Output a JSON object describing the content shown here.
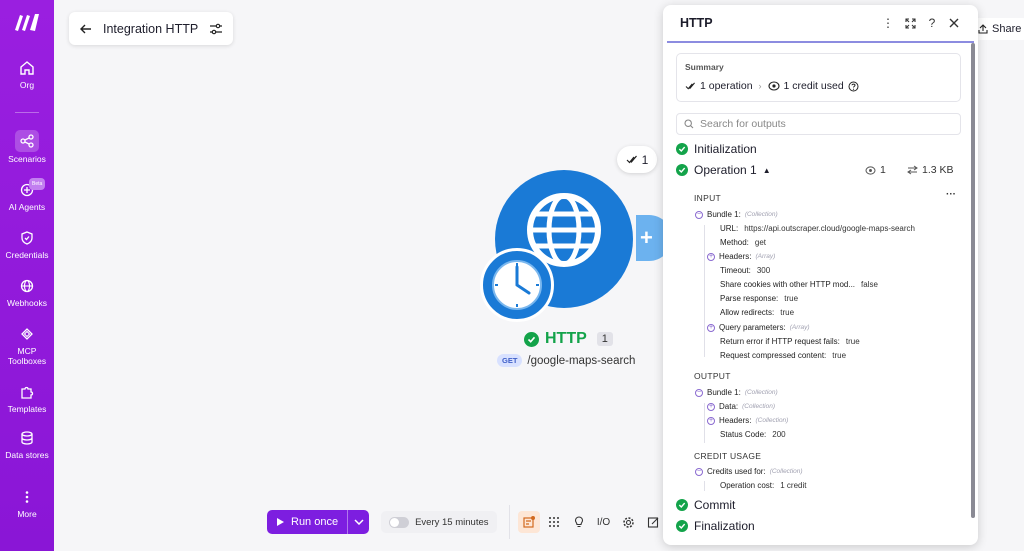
{
  "sidebar": {
    "items": [
      {
        "label": "Org",
        "icon": "home-icon"
      },
      {
        "label": "Scenarios",
        "icon": "share-nodes-icon",
        "active": true
      },
      {
        "label": "AI Agents",
        "icon": "ai-agent-icon",
        "badge": "Beta"
      },
      {
        "label": "Credentials",
        "icon": "shield-icon"
      },
      {
        "label": "Webhooks",
        "icon": "globe-icon"
      },
      {
        "label": "MCP Toolboxes",
        "icon": "mcp-icon"
      },
      {
        "label": "Templates",
        "icon": "puzzle-icon"
      },
      {
        "label": "Data stores",
        "icon": "database-icon"
      },
      {
        "label": "More",
        "icon": "more-vertical-icon"
      }
    ]
  },
  "header": {
    "scenario_title": "Integration HTTP",
    "share_label": "Share"
  },
  "canvas": {
    "node_name": "HTTP",
    "node_count": "1",
    "method": "GET",
    "path": "/google-maps-search",
    "ops_badge": "1"
  },
  "toolbar": {
    "run_label": "Run once",
    "schedule_label": "Every 15 minutes",
    "io_label": "I/O"
  },
  "panel": {
    "title": "HTTP",
    "summary_label": "Summary",
    "operations": "1 operation",
    "credits": "1 credit used",
    "search_placeholder": "Search for outputs",
    "steps": {
      "initialization": "Initialization",
      "operation": "Operation 1",
      "commit": "Commit",
      "finalization": "Finalization"
    },
    "op_ops": "1",
    "op_size": "1.3 KB",
    "input_title": "INPUT",
    "output_title": "OUTPUT",
    "credit_title": "CREDIT USAGE",
    "input": {
      "bundle": "Bundle 1:",
      "bundle_type": "(Collection)",
      "url_key": "URL:",
      "url_val": "https://api.outscraper.cloud/google-maps-search",
      "method_key": "Method:",
      "method_val": "get",
      "headers_key": "Headers:",
      "headers_type": "(Array)",
      "timeout_key": "Timeout:",
      "timeout_val": "300",
      "cookies_key": "Share cookies with other HTTP mod...",
      "cookies_val": "false",
      "parse_key": "Parse response:",
      "parse_val": "true",
      "redirect_key": "Allow redirects:",
      "redirect_val": "true",
      "query_key": "Query parameters:",
      "query_type": "(Array)",
      "error_key": "Return error if HTTP request fails:",
      "error_val": "true",
      "compressed_key": "Request compressed content:",
      "compressed_val": "true"
    },
    "output": {
      "bundle": "Bundle 1:",
      "bundle_type": "(Collection)",
      "data_key": "Data:",
      "data_type": "(Collection)",
      "headers_key": "Headers:",
      "headers_type": "(Collection)",
      "status_key": "Status Code:",
      "status_val": "200"
    },
    "credit": {
      "credits_key": "Credits used for:",
      "credits_type": "(Collection)",
      "cost_key": "Operation cost:",
      "cost_val": "1 credit"
    }
  },
  "colors": {
    "sidebar": "#8a16d6",
    "accent": "#7d1ee0",
    "node": "#1a7ad6",
    "success": "#13a34a"
  }
}
